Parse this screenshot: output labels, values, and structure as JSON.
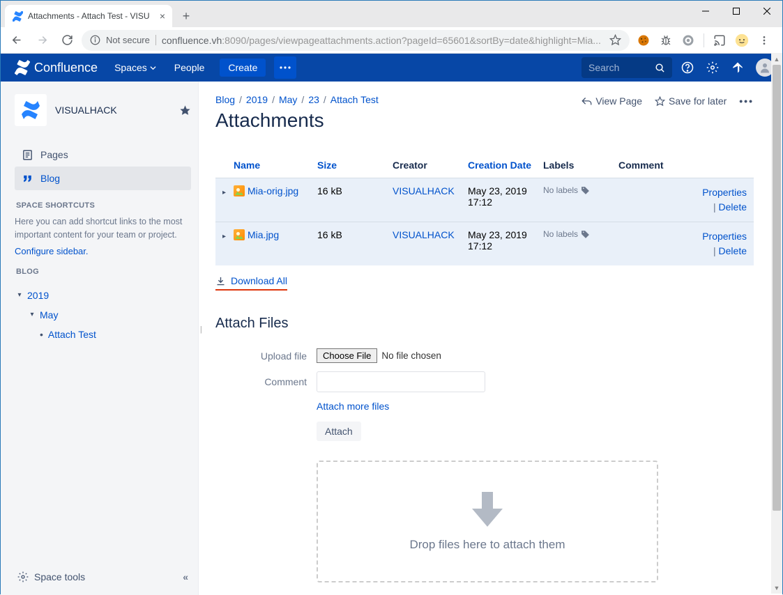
{
  "browser": {
    "tab_title": "Attachments - Attach Test - VISU",
    "url_host": "confluence.vh",
    "url_path": ":8090/pages/viewpageattachments.action?pageId=65601&sortBy=date&highlight=Mia...",
    "not_secure_label": "Not secure"
  },
  "header": {
    "product": "Confluence",
    "nav": {
      "spaces": "Spaces",
      "people": "People"
    },
    "create": "Create",
    "search_placeholder": "Search"
  },
  "sidebar": {
    "space_name": "VISUALHACK",
    "pages": "Pages",
    "blog": "Blog",
    "shortcuts_heading": "SPACE SHORTCUTS",
    "shortcuts_hint": "Here you can add shortcut links to the most important content for your team or project.",
    "configure_link": "Configure sidebar.",
    "blog_heading": "BLOG",
    "tree": {
      "year": "2019",
      "month": "May",
      "page": "Attach Test"
    },
    "footer": "Space tools"
  },
  "breadcrumbs": [
    "Blog",
    "2019",
    "May",
    "23",
    "Attach Test"
  ],
  "page": {
    "title": "Attachments",
    "actions": {
      "view_page": "View Page",
      "save_later": "Save for later"
    }
  },
  "table": {
    "headers": {
      "name": "Name",
      "size": "Size",
      "creator": "Creator",
      "date": "Creation Date",
      "labels": "Labels",
      "comment": "Comment"
    },
    "rows": [
      {
        "name": "Mia-orig.jpg",
        "size": "16 kB",
        "creator": "VISUALHACK",
        "date": "May 23, 2019 17:12",
        "labels": "No labels",
        "properties": "Properties",
        "delete": "Delete"
      },
      {
        "name": "Mia.jpg",
        "size": "16 kB",
        "creator": "VISUALHACK",
        "date": "May 23, 2019 17:12",
        "labels": "No labels",
        "properties": "Properties",
        "delete": "Delete"
      }
    ],
    "download_all": "Download All"
  },
  "attach": {
    "heading": "Attach Files",
    "upload_label": "Upload file",
    "choose_file": "Choose File",
    "no_file": "No file chosen",
    "comment_label": "Comment",
    "attach_more": "Attach more files",
    "submit": "Attach",
    "dropzone": "Drop files here to attach them"
  }
}
